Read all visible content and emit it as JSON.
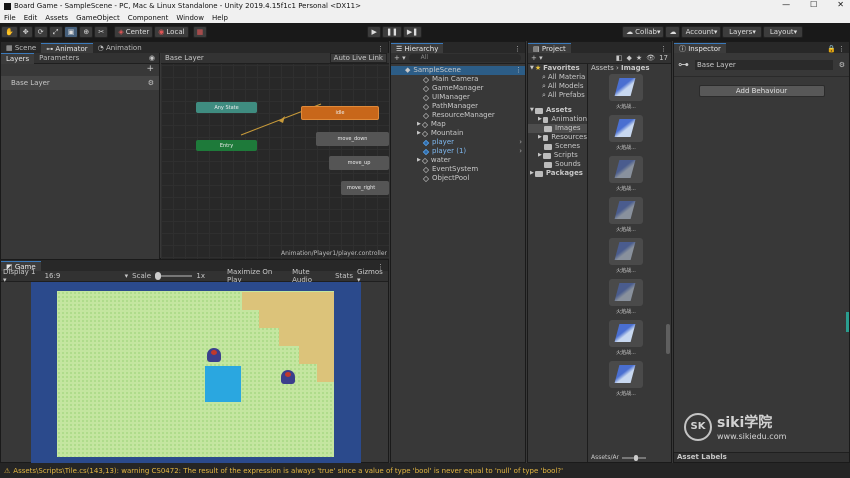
{
  "window": {
    "title": "Board Game - SampleScene - PC, Mac & Linux Standalone - Unity 2019.4.15f1c1 Personal <DX11>",
    "min": "—",
    "max": "☐",
    "close": "✕"
  },
  "menu": [
    "File",
    "Edit",
    "Assets",
    "GameObject",
    "Component",
    "Window",
    "Help"
  ],
  "toolbar": {
    "center": "Center",
    "local": "Local",
    "collab": "Collab",
    "account": "Account",
    "layers": "Layers",
    "layout": "Layout"
  },
  "animator": {
    "tabs": {
      "scene": "Scene",
      "animator": "Animator",
      "animation": "Animation"
    },
    "sub_tabs": {
      "layers": "Layers",
      "parameters": "Parameters"
    },
    "breadcrumb": "Base Layer",
    "auto_live_link": "Auto Live Link",
    "layer_name": "Base Layer",
    "states": {
      "any": "Any State",
      "entry": "Entry",
      "idle": "idle",
      "move_down": "move_down",
      "move_up": "move_up",
      "move_right": "move_right"
    },
    "path": "Animation/Player1/player.controller"
  },
  "game": {
    "tab": "Game",
    "display": "Display 1",
    "aspect": "16:9",
    "scale_label": "Scale",
    "scale_value": "1x",
    "maximize": "Maximize On Play",
    "mute": "Mute Audio",
    "stats": "Stats",
    "gizmos": "Gizmos"
  },
  "hierarchy": {
    "tab": "Hierarchy",
    "search_placeholder": "All",
    "scene": "SampleScene",
    "items": [
      "Main Camera",
      "GameManager",
      "UIManager",
      "PathManager",
      "ResourceManager",
      "Map",
      "Mountain",
      "player",
      "player (1)",
      "water",
      "EventSystem",
      "ObjectPool"
    ]
  },
  "project": {
    "tab": "Project",
    "count": "17",
    "favorites": {
      "label": "Favorites",
      "items": [
        "All Materia",
        "All Models",
        "All Prefabs"
      ]
    },
    "assets": {
      "label": "Assets",
      "items": [
        "Animation",
        "Images",
        "Resources",
        "Scenes",
        "Scripts",
        "Sounds"
      ]
    },
    "packages": "Packages",
    "breadcrumb": {
      "root": "Assets",
      "current": "Images"
    },
    "thumb_caption": "火焰战...",
    "thumb_count": 8,
    "footer_path": "Assets/Ar"
  },
  "inspector": {
    "tab": "Inspector",
    "title": "Base Layer",
    "add_behaviour": "Add Behaviour",
    "asset_labels": "Asset Labels"
  },
  "watermark": {
    "brand": "siki学院",
    "url": "www.sikiedu.com"
  },
  "status": "Assets\\Scripts\\Tile.cs(143,13): warning CS0472: The result of the expression is always 'true' since a value of type 'bool' is never equal to 'null' of type 'bool?'",
  "colors": {
    "accent": "#3a79bb",
    "idle_state": "#c8671a",
    "entry_state": "#1e7a3a",
    "any_state": "#3f8c80",
    "game_bg": "#2b4a8c",
    "warning": "#e6b843"
  }
}
